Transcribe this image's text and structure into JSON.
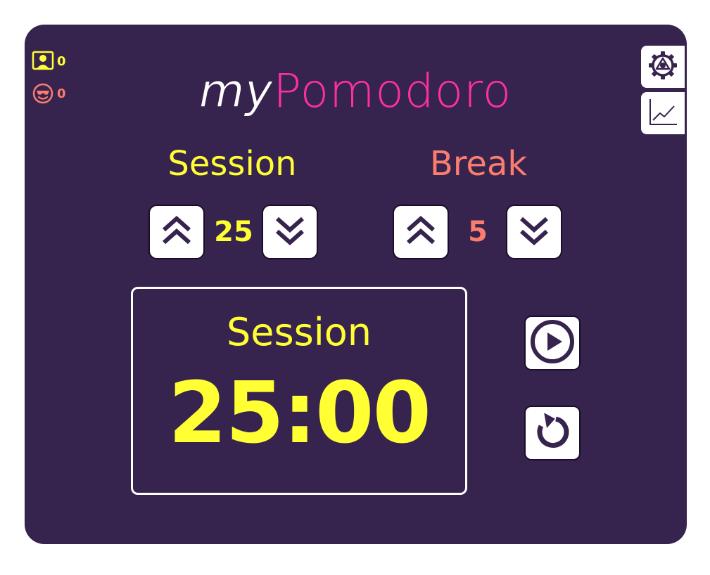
{
  "app": {
    "title_my": "my",
    "title_pomodoro": "Pomodoro"
  },
  "counters": {
    "sessions_icon": "user-portrait-icon",
    "sessions_count": "0",
    "breaks_icon": "cool-face-icon",
    "breaks_count": "0"
  },
  "session": {
    "label": "Session",
    "length": "25",
    "increment_icon": "double-chevron-up-icon",
    "decrement_icon": "double-chevron-down-icon"
  },
  "break": {
    "label": "Break",
    "length": "5",
    "increment_icon": "double-chevron-up-icon",
    "decrement_icon": "double-chevron-down-icon"
  },
  "timer": {
    "label": "Session",
    "time": "25:00"
  },
  "controls": {
    "play_icon": "play-icon",
    "reset_icon": "reset-icon"
  },
  "side_tabs": {
    "settings_icon": "gear-icon",
    "stats_icon": "line-chart-icon"
  },
  "colors": {
    "background": "#37244e",
    "session": "#ffff33",
    "break": "#fa7d6e",
    "accent": "#ff2fa3",
    "white": "#ffffff"
  }
}
